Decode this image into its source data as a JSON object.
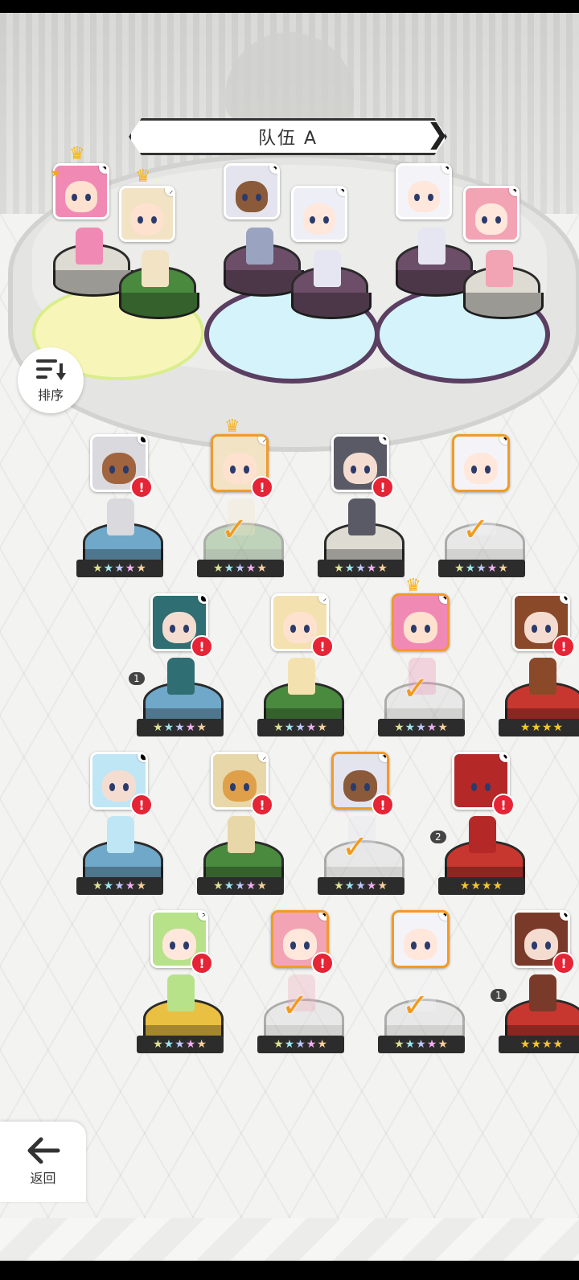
{
  "header": {
    "team_title": "队伍 A"
  },
  "controls": {
    "sort_label": "排序",
    "back_label": "返回"
  },
  "colors": {
    "selected": "#f29a2a",
    "alert": "#e52435",
    "crown": "#f5b61a"
  },
  "team": [
    {
      "hair": "#f08ab4",
      "skin": "#ffe1cf",
      "crown": true,
      "leader_star": true,
      "element": "✦",
      "pedestal": "#dedbd2",
      "sprite": "#f08ab4"
    },
    {
      "hair": "#f2e3c5",
      "skin": "#ffe1cf",
      "crown": true,
      "element": "⸝",
      "pedestal": "#4a8a3f",
      "sprite": "#f2e3c5"
    },
    {
      "hair": "#e4e4ee",
      "skin": "#8a5a3a",
      "element": "✦",
      "pedestal": "#6c4e68",
      "sprite": "#9aa4c0"
    },
    {
      "hair": "#eeeef6",
      "skin": "#ffe7dc",
      "element": "✦",
      "pedestal": "#6c4e68",
      "sprite": "#e6e6f2"
    },
    {
      "hair": "#f4f4f8",
      "skin": "#ffe7dc",
      "element": "✦",
      "pedestal": "#6c4e68",
      "sprite": "#e6e6f2"
    },
    {
      "hair": "#f3a4b4",
      "skin": "#ffe7dc",
      "element": "✦",
      "pedestal": "#dedbd2",
      "sprite": "#f3a4b4"
    }
  ],
  "roster": [
    {
      "hair": "#d9d9de",
      "skin": "#a0643f",
      "element": "●",
      "pedestal": "#6fa8c8",
      "stars": "★★★★★",
      "alert": "!",
      "selected": false
    },
    {
      "hair": "#f2e3c5",
      "skin": "#ffe1cf",
      "element": "⸝",
      "pedestal": "#5e9a55",
      "stars": "★★★★★",
      "alert": "!",
      "selected": true,
      "crown": true,
      "check": "✓"
    },
    {
      "hair": "#5a5a66",
      "skin": "#f4ddd0",
      "element": "✦",
      "pedestal": "#dedbd2",
      "stars": "★★★★★",
      "alert": "!",
      "selected": false
    },
    {
      "hair": "#f4f4f8",
      "skin": "#ffe7dc",
      "element": "✦",
      "pedestal": "#d6d6d8",
      "stars": "★★★★★",
      "selected": true,
      "check": "✓"
    },
    {
      "hair": "#2f6e72",
      "skin": "#f4ddd0",
      "element": "●",
      "pedestal": "#6fa8c8",
      "stars": "★★★★★",
      "alert": "!",
      "selected": false,
      "dup": "1"
    },
    {
      "hair": "#f3e2b0",
      "skin": "#ffe1cf",
      "element": "⸝",
      "pedestal": "#4a8a3f",
      "stars": "★★★★★",
      "alert": "!",
      "selected": false
    },
    {
      "hair": "#f08ab4",
      "skin": "#ffe1cf",
      "element": "✦",
      "pedestal": "#d6d6d8",
      "stars": "★★★★★",
      "selected": true,
      "crown": true,
      "check": "✓"
    },
    {
      "hair": "#8a4a2a",
      "skin": "#f4ddd0",
      "element": "♦",
      "pedestal": "#c8372f",
      "stars": "★★★★",
      "gold": true,
      "alert": "!",
      "selected": false
    },
    {
      "hair": "#bfe6f4",
      "skin": "#f4ddd0",
      "element": "●",
      "pedestal": "#6fa8c8",
      "stars": "★★★★★",
      "alert": "!",
      "selected": false
    },
    {
      "hair": "#e8d7a8",
      "skin": "#e0a04a",
      "element": "⸝",
      "pedestal": "#4a8a3f",
      "stars": "★★★★★",
      "alert": "!",
      "selected": false
    },
    {
      "hair": "#e4e4ee",
      "skin": "#8a5a3a",
      "element": "✦",
      "pedestal": "#d6d6d8",
      "stars": "★★★★★",
      "alert": "!",
      "selected": true,
      "check": "✓"
    },
    {
      "hair": "#b42828",
      "skin": "#b42828",
      "element": "♦",
      "pedestal": "#c8372f",
      "stars": "★★★★",
      "gold": true,
      "alert": "!",
      "selected": false,
      "dup": "2"
    },
    {
      "hair": "#b8e28a",
      "skin": "#ffe7dc",
      "element": "⚡",
      "pedestal": "#e9c042",
      "stars": "★★★★★",
      "alert": "!",
      "selected": false
    },
    {
      "hair": "#f3a4b4",
      "skin": "#ffe7dc",
      "element": "✦",
      "pedestal": "#d6d6d8",
      "stars": "★★★★★",
      "alert": "!",
      "selected": true,
      "check": "✓"
    },
    {
      "hair": "#f4f4f8",
      "skin": "#ffe7dc",
      "element": "✦",
      "pedestal": "#d6d6d8",
      "stars": "★★★★★",
      "selected": true,
      "check": "✓"
    },
    {
      "hair": "#7a3a2a",
      "skin": "#f4ddd0",
      "element": "♦",
      "pedestal": "#c8372f",
      "stars": "★★★★",
      "gold": true,
      "alert": "!",
      "selected": false,
      "dup": "1"
    }
  ]
}
